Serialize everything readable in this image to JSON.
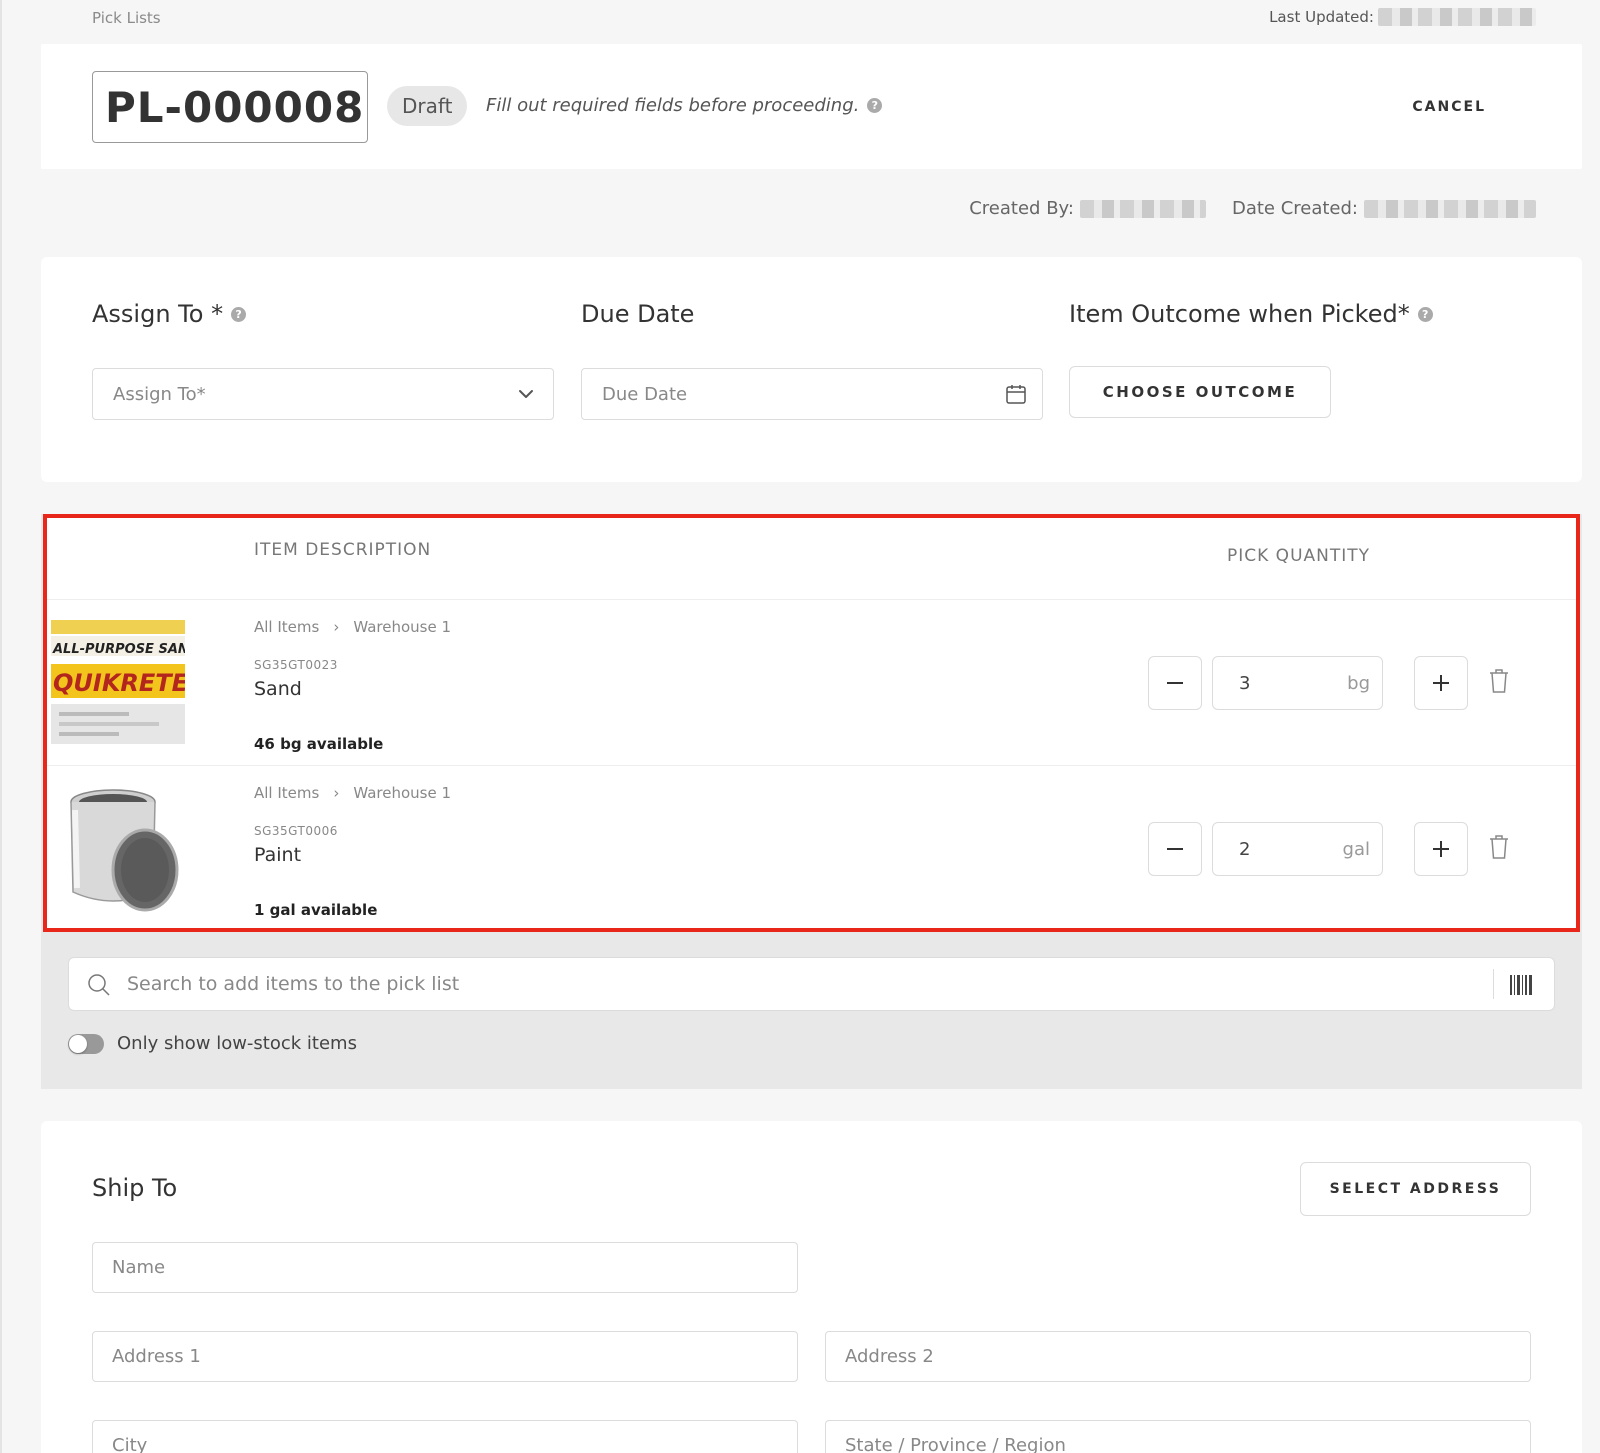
{
  "breadcrumb": "Pick Lists",
  "last_updated_label": "Last Updated:",
  "header": {
    "pick_list_id": "PL-000008",
    "status": "Draft",
    "status_message": "Fill out required fields before proceeding.",
    "cancel_label": "CANCEL"
  },
  "meta": {
    "created_by_label": "Created By:",
    "date_created_label": "Date Created:"
  },
  "assignment": {
    "assign_to_label": "Assign To *",
    "assign_to_placeholder": "Assign To*",
    "due_date_label": "Due Date",
    "due_date_placeholder": "Due Date",
    "outcome_label": "Item Outcome when Picked*",
    "choose_outcome_label": "CHOOSE OUTCOME"
  },
  "items_table": {
    "col_description": "ITEM DESCRIPTION",
    "col_quantity": "PICK QUANTITY",
    "rows": [
      {
        "path": [
          "All Items",
          "Warehouse 1"
        ],
        "sku": "SG35GT0023",
        "name": "Sand",
        "quantity": "3",
        "unit": "bg",
        "available": "46 bg available",
        "image_text": [
          "ALL-PURPOSE SAN",
          "QUIKRETE"
        ]
      },
      {
        "path": [
          "All Items",
          "Warehouse 1"
        ],
        "sku": "SG35GT0006",
        "name": "Paint",
        "quantity": "2",
        "unit": "gal",
        "available": "1 gal available"
      }
    ]
  },
  "search": {
    "placeholder": "Search to add items to the pick list",
    "low_stock_label": "Only show low-stock items"
  },
  "ship_to": {
    "title": "Ship To",
    "select_address_label": "SELECT ADDRESS",
    "name_placeholder": "Name",
    "address1_placeholder": "Address 1",
    "address2_placeholder": "Address 2",
    "city_placeholder": "City",
    "state_placeholder": "State / Province / Region"
  },
  "colors": {
    "highlight_border": "#e8261a",
    "status_pill_bg": "#e7e7e7",
    "panel_bg": "#e8e8e8"
  }
}
